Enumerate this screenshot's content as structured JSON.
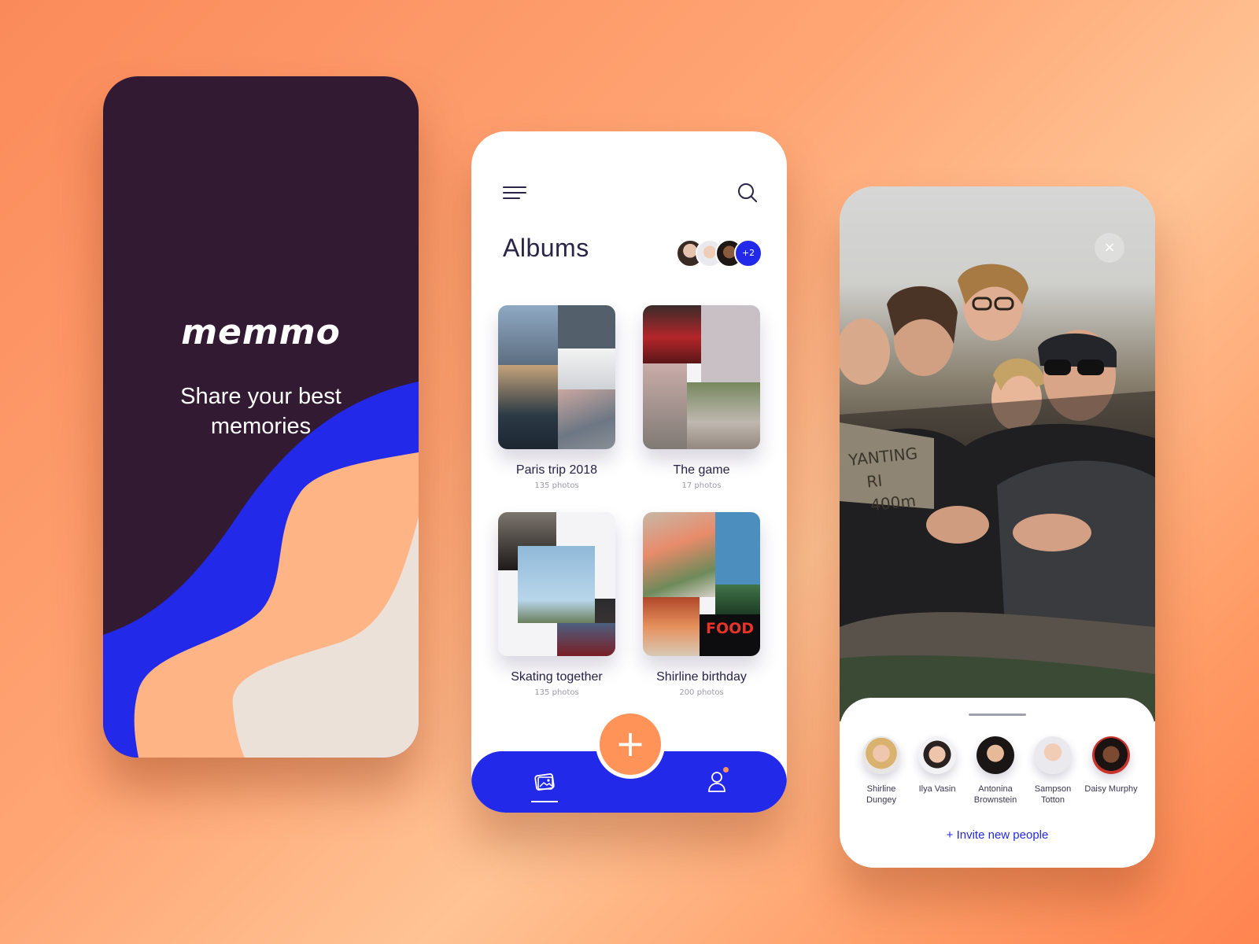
{
  "brand": {
    "logo": "memmo",
    "tagline": "Share your best memories",
    "accent": "#2329e8",
    "orange": "#ff9358",
    "dark": "#321a33"
  },
  "albums_screen": {
    "title": "Albums",
    "collaborators_extra": "+2",
    "albums": [
      {
        "name": "Paris trip 2018",
        "count": "135 photos"
      },
      {
        "name": "The game",
        "count": "17 photos"
      },
      {
        "name": "Skating together",
        "count": "135 photos"
      },
      {
        "name": "Shirline birthday",
        "count": "200 photos"
      }
    ],
    "fab_icon": "+",
    "tabs": [
      "photos-icon",
      "profile-icon"
    ]
  },
  "share_screen": {
    "close_icon": "×",
    "people": [
      {
        "name": "Shirline Dungey"
      },
      {
        "name": "Ilya Vasin"
      },
      {
        "name": "Antonina Brownstein"
      },
      {
        "name": "Sampson Totton"
      },
      {
        "name": "Daisy Murphy"
      }
    ],
    "invite": "+ Invite new people"
  }
}
